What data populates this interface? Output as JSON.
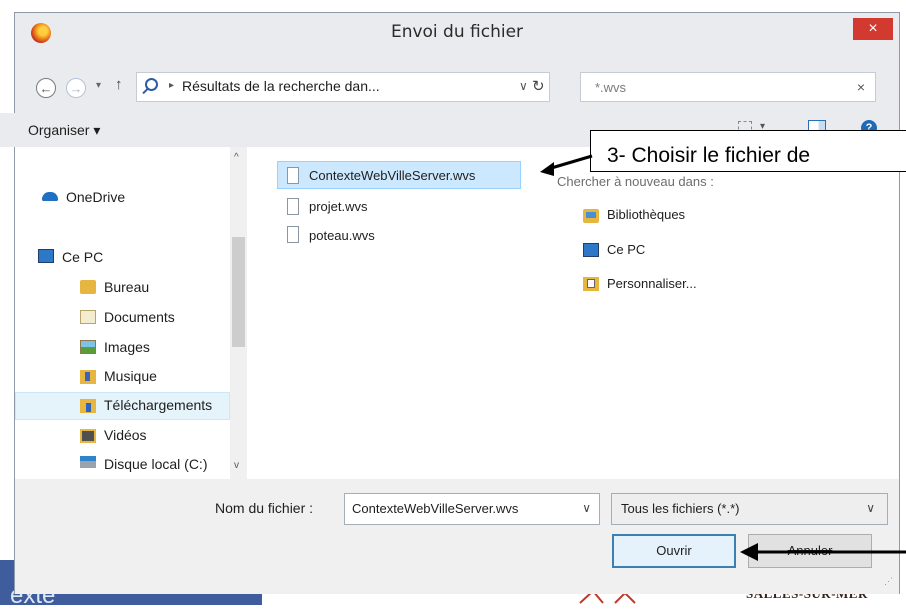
{
  "background": {
    "left_text": "exte",
    "right_text": "SALLES-SUR-MER"
  },
  "dialog": {
    "title": "Envoi du fichier",
    "close_glyph": "×"
  },
  "nav": {
    "back_glyph": "←",
    "forward_glyph": "→",
    "up_glyph": "↑",
    "dropdown_glyph": "▾",
    "refresh_glyph": "↻"
  },
  "address": {
    "chevron": "▸",
    "path": "Résultats de la recherche dan...",
    "dropdown_glyph": "∨"
  },
  "search": {
    "value": "*.wvs",
    "clear_glyph": "×"
  },
  "toolbar": {
    "organiser_label": "Organiser ▾",
    "view_dropdown_glyph": "▾",
    "help_glyph": "?"
  },
  "sidebar": {
    "items": [
      {
        "label": "OneDrive",
        "icon": "cloud-icon"
      },
      {
        "label": "Ce PC",
        "icon": "pc-icon"
      },
      {
        "label": "Bureau",
        "icon": "desktop-folder-icon"
      },
      {
        "label": "Documents",
        "icon": "documents-folder-icon"
      },
      {
        "label": "Images",
        "icon": "images-folder-icon"
      },
      {
        "label": "Musique",
        "icon": "music-folder-icon"
      },
      {
        "label": "Téléchargements",
        "icon": "downloads-folder-icon",
        "selected": true
      },
      {
        "label": "Vidéos",
        "icon": "videos-folder-icon"
      },
      {
        "label": "Disque local (C:)",
        "icon": "disk-icon"
      }
    ],
    "scroll_up_glyph": "^",
    "scroll_down_glyph": "v"
  },
  "files": [
    {
      "name": "ContexteWebVilleServer.wvs",
      "selected": true
    },
    {
      "name": "projet.wvs"
    },
    {
      "name": "poteau.wvs"
    }
  ],
  "search_again": {
    "heading": "Chercher à nouveau dans :",
    "items": [
      {
        "label": "Bibliothèques",
        "icon": "libraries-icon"
      },
      {
        "label": "Ce PC",
        "icon": "pc-icon"
      },
      {
        "label": "Personnaliser...",
        "icon": "customize-icon"
      }
    ]
  },
  "annotation": {
    "text": "3- Choisir le fichier de"
  },
  "footer": {
    "filename_label": "Nom du fichier :",
    "filename_value": "ContexteWebVilleServer.wvs",
    "filter_value": "Tous les fichiers (*.*)",
    "dropdown_glyph": "∨",
    "open_label": "Ouvrir",
    "cancel_label": "Annuler",
    "grip_glyph": "⋰"
  },
  "colors": {
    "accent": "#3c7fb1",
    "close": "#d33a2f",
    "selection": "#cce8ff"
  }
}
